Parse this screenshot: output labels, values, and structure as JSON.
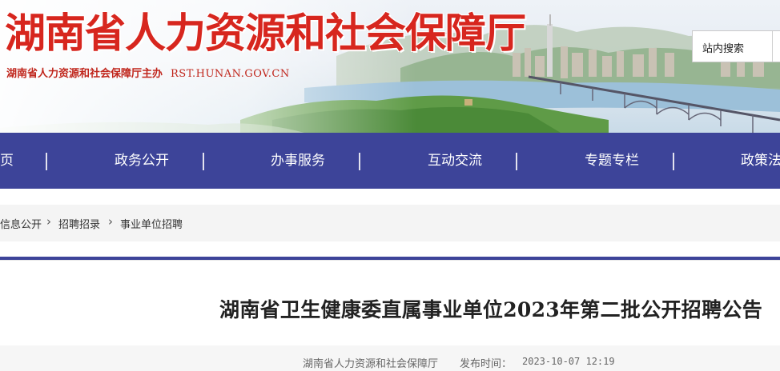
{
  "site": {
    "title": "湖南省人力资源和社会保障厅",
    "subtitle": "湖南省人力资源和社会保障厅主办",
    "url": "RST.HUNAN.GOV.CN"
  },
  "search": {
    "label": "站内搜索"
  },
  "nav": {
    "items": [
      {
        "label": "页"
      },
      {
        "label": "政务公开"
      },
      {
        "label": "办事服务"
      },
      {
        "label": "互动交流"
      },
      {
        "label": "专题专栏"
      },
      {
        "label": "政策法"
      }
    ]
  },
  "breadcrumb": {
    "items": [
      {
        "label": "信息公开"
      },
      {
        "label": "招聘招录"
      },
      {
        "label": "事业单位招聘"
      }
    ],
    "separator": "›"
  },
  "article": {
    "title": "湖南省卫生健康委直属事业单位2023年第二批公开招聘公告",
    "source": "湖南省人力资源和社会保障厅",
    "publish_label": "发布时间：",
    "publish_time": "2023-10-07 12:19"
  },
  "colors": {
    "nav_bg": "#3d4499",
    "title_red": "#d7261e"
  }
}
